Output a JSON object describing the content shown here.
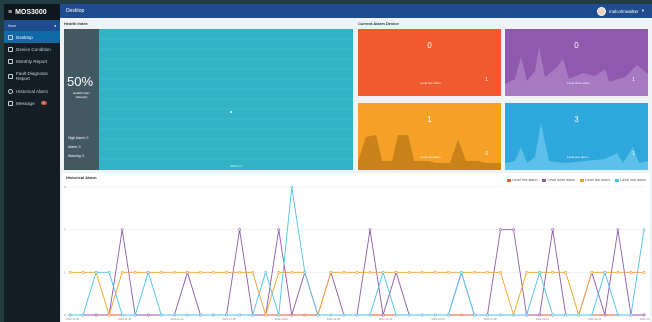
{
  "app": {
    "title": "MOS3000"
  },
  "sidebar": {
    "subheader": "Now",
    "items": [
      {
        "label": "Desktop"
      },
      {
        "label": "Device Condition"
      },
      {
        "label": "Monthly Report"
      },
      {
        "label": "Fault Diagnosis Report"
      },
      {
        "label": "Historical Alarm"
      },
      {
        "label": "Message",
        "badge": "0"
      }
    ]
  },
  "header": {
    "page_title": "Desktop",
    "username": "malcolmwalker"
  },
  "health": {
    "title": "Health Index",
    "percent": "50%",
    "percent_label": "Health index (Danger)",
    "alarm_lines": [
      "High Alarm: 0",
      "Alarm: 0",
      "Warning: 0"
    ],
    "x_label": "2022-1-1"
  },
  "current_alarm": {
    "title": "Current Alarm Device",
    "tiles": [
      {
        "value": "0",
        "label": "Level five alarm",
        "count": "1",
        "color": "#ef5a30"
      },
      {
        "value": "0",
        "label": "Level three alarm",
        "count": "1",
        "color": "#8f5aae"
      },
      {
        "value": "1",
        "label": "Level two alarm",
        "count": "0",
        "color": "#f5a026"
      },
      {
        "value": "3",
        "label": "Level one alarm",
        "count": "1",
        "color": "#2ea7dd"
      }
    ]
  },
  "historical": {
    "title": "Historical Alarm",
    "legend": [
      {
        "name": "Level five alarm",
        "color": "#ef5a30"
      },
      {
        "name": "Level three alarm",
        "color": "#8f5aae"
      },
      {
        "name": "Level two alarm",
        "color": "#f5a026"
      },
      {
        "name": "Level one alarm",
        "color": "#4cc3e6"
      }
    ]
  },
  "chart_data": {
    "type": "line",
    "title": "Historical Alarm",
    "ylim": [
      0,
      3
    ],
    "x_tick_labels": [
      "2022-11-06",
      "2022-11-07",
      "2022-11-08",
      "2022-11-09",
      "2022-11-10",
      "2022-11-11",
      "2022-11-12",
      "2022-11-13",
      "2022-11-14",
      "2022-11-15",
      "2022-11-16",
      "2022-11-17",
      "2022-11-18",
      "2022-11-19",
      "2022-11-20",
      "2022-11-21",
      "2022-11-22",
      "2022-11-23",
      "2022-11-24",
      "2022-11-25",
      "2022-11-26",
      "2022-11-27",
      "2022-11-28",
      "2022-11-29",
      "2022-11-30",
      "2022-12-01",
      "2022-12-02",
      "2022-12-03",
      "2022-12-04",
      "2022-12-05",
      "2022-12-06",
      "2022-12-07",
      "2022-12-08",
      "2022-12-09",
      "2022-12-10",
      "2022-12-11",
      "2022-12-12",
      "2022-12-13",
      "2022-12-14",
      "2022-12-15",
      "2022-12-16",
      "2022-12-17",
      "2022-12-18",
      "2022-12-19",
      "2022-12-20"
    ],
    "series": [
      {
        "name": "Level five alarm",
        "color": "#ef5a30",
        "values": [
          0,
          0,
          0,
          0,
          0,
          0,
          0,
          0,
          0,
          0,
          0,
          0,
          0,
          0,
          0,
          0,
          0,
          0,
          0,
          0,
          0,
          0,
          0,
          0,
          0,
          0,
          0,
          0,
          0,
          0,
          0,
          0,
          0,
          0,
          0,
          0,
          0,
          0,
          0,
          0,
          0,
          0,
          0,
          0,
          0
        ]
      },
      {
        "name": "Level three alarm",
        "color": "#8f5aae",
        "values": [
          0,
          0,
          0,
          0,
          2,
          0,
          0,
          0,
          0,
          1,
          0,
          0,
          0,
          2,
          0,
          0,
          2,
          0,
          1,
          0,
          1,
          0,
          0,
          2,
          0,
          1,
          0,
          0,
          0,
          0,
          1,
          0,
          0,
          2,
          2,
          0,
          0,
          2,
          0,
          0,
          1,
          0,
          2,
          0,
          0
        ]
      },
      {
        "name": "Level two alarm",
        "color": "#f5a026",
        "values": [
          1,
          1,
          1,
          0,
          1,
          1,
          1,
          1,
          1,
          1,
          1,
          1,
          1,
          1,
          1,
          0,
          1,
          1,
          1,
          0,
          1,
          1,
          1,
          1,
          1,
          1,
          1,
          1,
          1,
          1,
          1,
          1,
          1,
          1,
          0,
          1,
          1,
          1,
          1,
          0,
          1,
          1,
          1,
          1,
          1
        ]
      },
      {
        "name": "Level one alarm",
        "color": "#4cc3e6",
        "values": [
          0,
          0,
          1,
          1,
          0,
          0,
          1,
          0,
          0,
          0,
          0,
          0,
          0,
          0,
          0,
          1,
          0,
          3,
          1,
          0,
          0,
          0,
          0,
          0,
          1,
          0,
          0,
          0,
          0,
          0,
          1,
          0,
          0,
          0,
          0,
          0,
          1,
          0,
          0,
          0,
          0,
          1,
          0,
          0,
          2
        ]
      }
    ]
  }
}
